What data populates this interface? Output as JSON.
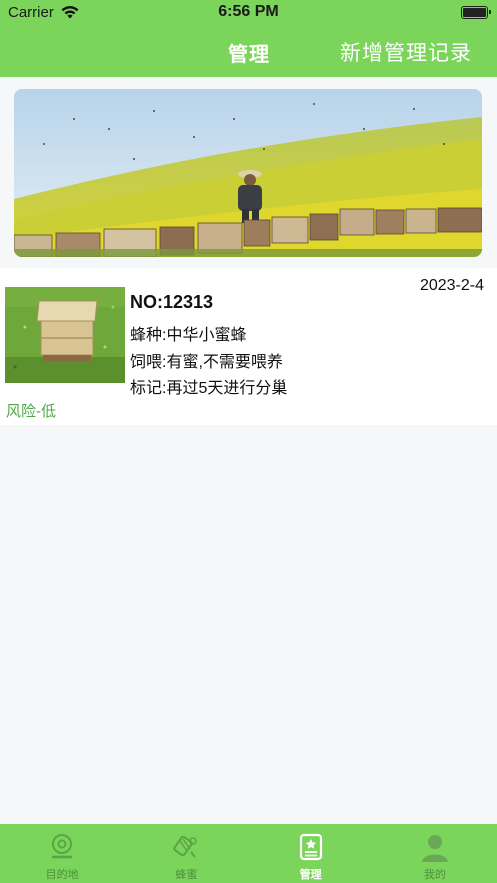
{
  "status_bar": {
    "carrier": "Carrier",
    "time": "6:56 PM"
  },
  "nav": {
    "title": "管理",
    "action": "新增管理记录"
  },
  "record": {
    "date": "2023-2-4",
    "no": "NO:12313",
    "species": "蜂种:中华小蜜蜂",
    "feeding": "饲喂:有蜜,不需要喂养",
    "note": "标记:再过5天进行分巢",
    "risk": "风险-低"
  },
  "tabs": [
    {
      "label": "目的地",
      "icon": "location-icon"
    },
    {
      "label": "蜂蜜",
      "icon": "bee-icon"
    },
    {
      "label": "管理",
      "icon": "clipboard-icon",
      "active": true
    },
    {
      "label": "我的",
      "icon": "user-icon"
    }
  ],
  "colors": {
    "primary": "#7bd55b",
    "risk": "#4fa74a",
    "background": "#f6f7f8"
  }
}
